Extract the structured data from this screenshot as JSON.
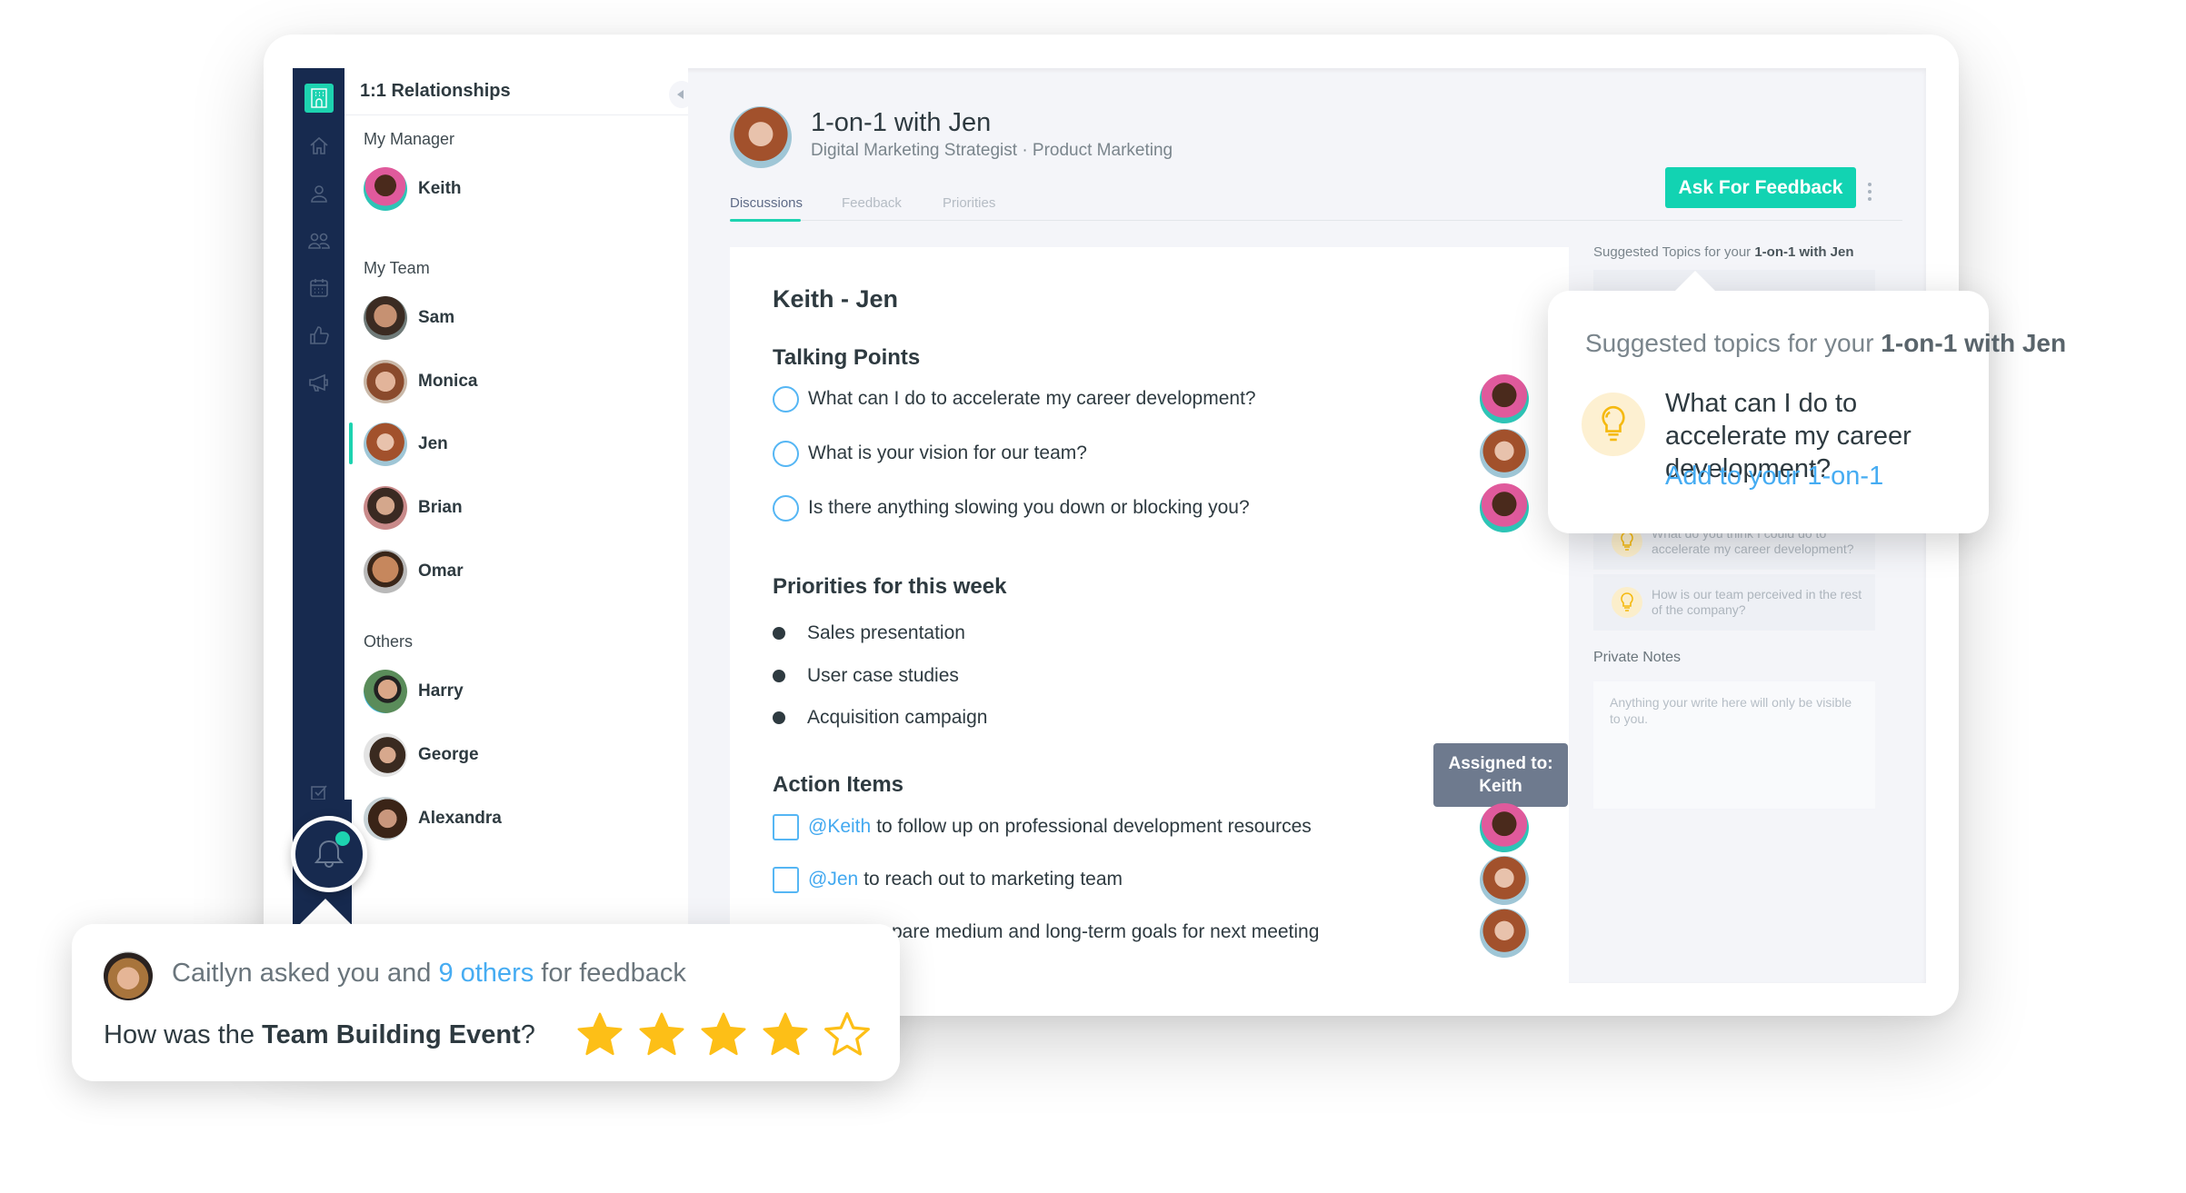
{
  "sidebar_nav": {
    "icons": [
      "building-icon",
      "home-icon",
      "user-icon",
      "team-icon",
      "calendar-icon",
      "thumbs-up-icon",
      "megaphone-icon",
      "checkbox-icon"
    ]
  },
  "relationships": {
    "title": "1:1 Relationships",
    "sections": [
      {
        "label": "My Manager",
        "people": [
          {
            "name": "Keith"
          }
        ]
      },
      {
        "label": "My Team",
        "people": [
          {
            "name": "Sam"
          },
          {
            "name": "Monica"
          },
          {
            "name": "Jen",
            "active": true
          },
          {
            "name": "Brian"
          },
          {
            "name": "Omar"
          }
        ]
      },
      {
        "label": "Others",
        "people": [
          {
            "name": "Harry"
          },
          {
            "name": "George"
          },
          {
            "name": "Alexandra"
          }
        ]
      }
    ]
  },
  "header": {
    "title": "1-on-1 with Jen",
    "subtitle": "Digital Marketing Strategist · Product Marketing",
    "tabs": [
      {
        "label": "Discussions",
        "active": true
      },
      {
        "label": "Feedback"
      },
      {
        "label": "Priorities"
      }
    ],
    "ask_button": "Ask For Feedback"
  },
  "discussion": {
    "title": "Keith - Jen",
    "talking_points": {
      "heading": "Talking Points",
      "items": [
        {
          "text": "What can I do to accelerate my career development?",
          "owner": "Keith"
        },
        {
          "text": "What is your vision for our team?",
          "owner": "Jen"
        },
        {
          "text": "Is there anything slowing you down or blocking you?",
          "owner": "Keith"
        }
      ]
    },
    "priorities": {
      "heading": "Priorities for this week",
      "items": [
        "Sales presentation",
        "User case studies",
        "Acquisition campaign"
      ]
    },
    "action_items": {
      "heading": "Action Items",
      "items": [
        {
          "mention": "@Keith",
          "text": "to follow up on professional development resources",
          "owner": "Keith"
        },
        {
          "mention": "@Jen",
          "text": "to reach out to marketing team",
          "owner": "Jen"
        },
        {
          "mention": "",
          "text": "pare medium and long-term goals for next meeting",
          "owner": "Jen"
        }
      ],
      "tooltip_label": "Assigned to:",
      "tooltip_name": "Keith"
    }
  },
  "side_panel": {
    "title_prefix": "Suggested Topics for your ",
    "title_bold": "1-on-1 with Jen",
    "suggestions": [
      "What do you think I could do to accelerate my career development?",
      "How is our team perceived in the rest of the company?"
    ],
    "notes_label": "Private Notes",
    "notes_placeholder": "Anything your write here will only be visible to you."
  },
  "popup": {
    "title_prefix": "Suggested topics for your ",
    "title_bold": "1-on-1 with Jen",
    "question": "What can I do to accelerate my career development?",
    "link": "Add to your 1-on-1"
  },
  "notification": {
    "has_unread": true
  },
  "feedback_request": {
    "requester": "Caitlyn",
    "text_1": "asked you and",
    "others_link": "9 others",
    "text_2": "for feedback",
    "question_prefix": "How was the",
    "event": "Team Building Event",
    "question_suffix": "?",
    "rating": 4,
    "max_rating": 5
  },
  "colors": {
    "accent": "#1dd3b0",
    "nav_bg": "#172a4f",
    "link": "#46acf2",
    "star": "#fdbf17",
    "tooltip": "#6e7a8e"
  }
}
